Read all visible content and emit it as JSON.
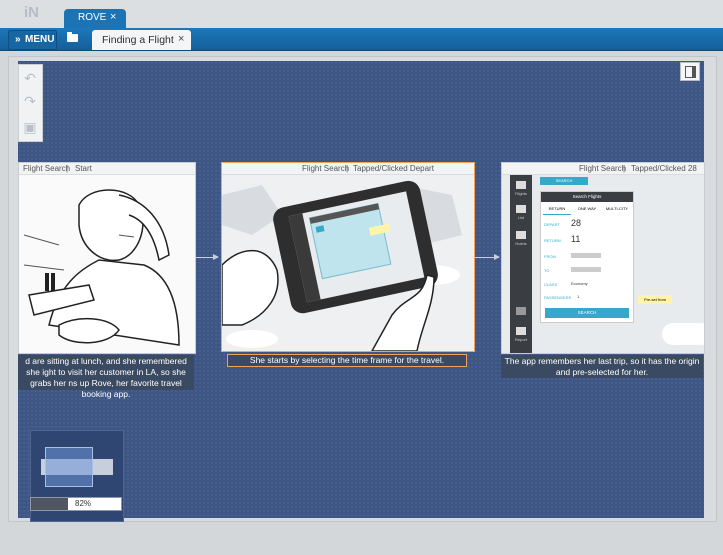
{
  "app": {
    "logo_text": "iN"
  },
  "tabs": {
    "document_tab": "ROVE",
    "document_close": "×",
    "flow_tab": "Finding a Flight",
    "flow_close": "×"
  },
  "toolbar": {
    "menu_label": "MENU",
    "menu_chevron": "»"
  },
  "tools": {
    "undo": "↶",
    "redo": "↷",
    "save": "▣"
  },
  "cards": [
    {
      "screen": "Flight Search",
      "sep": "|",
      "trigger": "Start",
      "caption": "d are sitting at lunch, and she remembered she ight to visit her customer in LA, so she grabs her ns up Rove, her favorite travel booking app."
    },
    {
      "screen": "Flight Search",
      "sep": "|",
      "trigger": "Tapped/Clicked Depart",
      "caption": "She starts by selecting the time frame for the travel."
    },
    {
      "screen": "Flight Search",
      "sep": "|",
      "trigger": "Tapped/Clicked 28",
      "caption": "The app remembers her last trip, so it has the origin and pre-selected for her."
    }
  ],
  "app_screen": {
    "search_btn": "SEARCH",
    "title": "Search Flights",
    "tabs": [
      "RETURN",
      "ONE WAY",
      "MULTI-CITY"
    ],
    "rows": [
      {
        "label": "DEPART",
        "value": "28"
      },
      {
        "label": "RETURN",
        "value": "11"
      },
      {
        "label": "FROM",
        "value": ""
      },
      {
        "label": "TO",
        "value": ""
      },
      {
        "label": "CLASS",
        "value": "Economy"
      },
      {
        "label": "PASSENGERS",
        "value": "1"
      }
    ],
    "search_button": "SEARCH",
    "note": "Pre-set from",
    "side_items": [
      "Flights",
      "List",
      "Hotels",
      "Report"
    ]
  },
  "zoom": {
    "percent": 82,
    "label": "82%"
  }
}
